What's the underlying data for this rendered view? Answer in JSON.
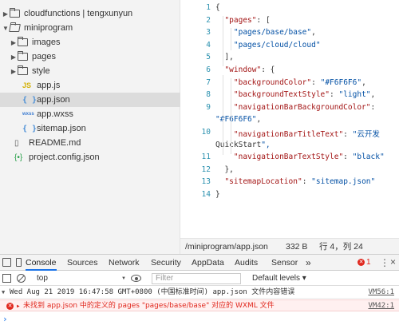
{
  "tree": {
    "items": [
      {
        "label": "cloudfunctions | tengxunyun",
        "icon": "cloud-folder-icon",
        "chevron": "collapsed"
      },
      {
        "label": "miniprogram",
        "icon": "folder-open-icon",
        "chevron": "expanded"
      },
      {
        "label": "images",
        "icon": "folder-icon",
        "chevron": "collapsed"
      },
      {
        "label": "pages",
        "icon": "folder-icon",
        "chevron": "collapsed"
      },
      {
        "label": "style",
        "icon": "folder-icon",
        "chevron": "collapsed"
      },
      {
        "label": "app.js",
        "icon": "js-file-icon",
        "glyph": "JS"
      },
      {
        "label": "app.json",
        "icon": "json-file-icon",
        "glyph": "{ }",
        "selected": true
      },
      {
        "label": "app.wxss",
        "icon": "wxss-file-icon",
        "glyph": "wxss"
      },
      {
        "label": "sitemap.json",
        "icon": "json-file-icon",
        "glyph": "{ }"
      },
      {
        "label": "README.md",
        "icon": "md-file-icon",
        "glyph": "▯"
      },
      {
        "label": "project.config.json",
        "icon": "config-file-icon",
        "glyph": "{•}"
      }
    ]
  },
  "editor": {
    "lines": [
      {
        "num": "1",
        "text": "{"
      },
      {
        "num": "2",
        "text": "  \"pages\": ["
      },
      {
        "num": "3",
        "text": "    \"pages/base/base\","
      },
      {
        "num": "4",
        "text": "    \"pages/cloud/cloud\""
      },
      {
        "num": "5",
        "text": "  ],"
      },
      {
        "num": "6",
        "text": "  \"window\": {"
      },
      {
        "num": "7",
        "text": "    \"backgroundColor\": \"#F6F6F6\","
      },
      {
        "num": "8",
        "text": "    \"backgroundTextStyle\": \"light\","
      },
      {
        "num": "9",
        "text": "    \"navigationBarBackgroundColor\":"
      },
      {
        "num": "",
        "text": "\"#F6F6F6\","
      },
      {
        "num": "10",
        "text": "    \"navigationBarTitleText\": \"云开发"
      },
      {
        "num": "",
        "text": "QuickStart\","
      },
      {
        "num": "11",
        "text": "    \"navigationBarTextStyle\": \"black\""
      },
      {
        "num": "12",
        "text": "  },"
      },
      {
        "num": "13",
        "text": "  \"sitemapLocation\": \"sitemap.json\""
      },
      {
        "num": "14",
        "text": "}"
      }
    ]
  },
  "status": {
    "path": "/miniprogram/app.json",
    "size": "332 B",
    "cursor": "行 4，列 24"
  },
  "devtools": {
    "tabs": [
      "Console",
      "Sources",
      "Network",
      "Security",
      "AppData",
      "Audits",
      "Sensor"
    ],
    "active_tab": "Console",
    "more_label": "»",
    "error_count": "1",
    "context": "top",
    "filter_placeholder": "Filter",
    "levels": "Default levels ▾",
    "log": {
      "text": "Wed Aug 21 2019 16:47:58 GMT+0800 (中国标准时间)  app.json 文件内容错误",
      "source": "VM56:1"
    },
    "error": {
      "text": "未找到 app.json 中的定义的 pages \"pages/base/base\" 对应的 WXML 文件",
      "source": "VM42:1"
    },
    "prompt": "›"
  },
  "colors": {
    "accent": "#1a73e8",
    "error": "#e0281e",
    "selection": "#dcdcdc"
  }
}
